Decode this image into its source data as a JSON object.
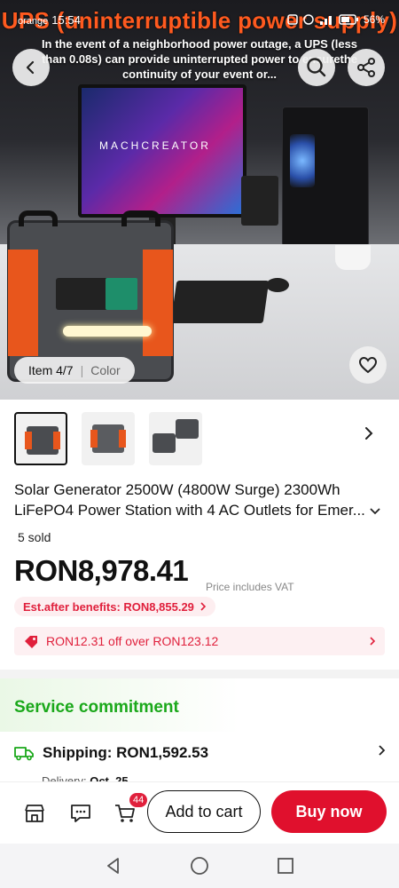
{
  "status_bar": {
    "carrier": "orange",
    "time": "15:54",
    "battery": "56%"
  },
  "banner": {
    "heading": "UPS (uninterruptible power supply)",
    "text": "In the event of a neighborhood power outage, a UPS (less than 0.08s) can provide uninterrupted power to ensurethe continuity of your event or..."
  },
  "hero": {
    "monitor_brand": "MACHCREATOR",
    "item_indicator": "Item 4/7",
    "color_label": "Color"
  },
  "product": {
    "title_line1": "Solar Generator 2500W (4800W Surge) 2300Wh",
    "title_line2": "LiFePO4 Power Station with 4 AC Outlets for Emer...",
    "sold": "5 sold",
    "price": "RON8,978.41",
    "vat_note": "Price includes VAT",
    "benefit": "Est.after benefits: RON8,855.29",
    "coupon": "RON12.31 off over RON123.12"
  },
  "service": {
    "title": "Service commitment",
    "shipping": "Shipping: RON1,592.53",
    "delivery_label": "Delivery:",
    "delivery_date": "Oct. 25"
  },
  "bottom_bar": {
    "cart_count": "44",
    "add_to_cart": "Add to cart",
    "buy_now": "Buy now"
  },
  "colors": {
    "accent_red": "#e0102d",
    "service_green": "#1aa81a",
    "orange": "#e8561c"
  }
}
